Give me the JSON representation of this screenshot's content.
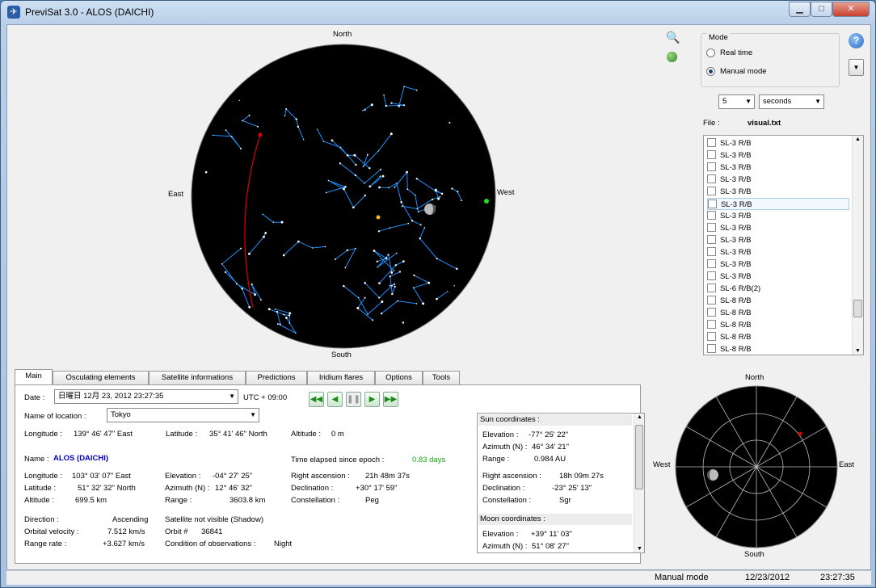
{
  "window": {
    "title": "PreviSat 3.0 - ALOS (DAICHI)",
    "minimize": "▁",
    "maximize": "□",
    "close": "✕"
  },
  "sky": {
    "north": "North",
    "south": "South",
    "east": "East",
    "west": "West"
  },
  "radar": {
    "north": "North",
    "south": "South",
    "east": "East",
    "west": "West"
  },
  "mode": {
    "title": "Mode",
    "real_time": "Real time",
    "manual": "Manual mode",
    "selected": "manual"
  },
  "step": {
    "value": "5",
    "unit": "seconds"
  },
  "file": {
    "label": "File :",
    "name": "visual.txt"
  },
  "satellites": [
    "SL-3 R/B",
    "SL-3 R/B",
    "SL-3 R/B",
    "SL-3 R/B",
    "SL-3 R/B",
    "SL-3 R/B",
    "SL-3 R/B",
    "SL-3 R/B",
    "SL-3 R/B",
    "SL-3 R/B",
    "SL-3 R/B",
    "SL-3 R/B",
    "SL-6 R/B(2)",
    "SL-8 R/B",
    "SL-8 R/B",
    "SL-8 R/B",
    "SL-8 R/B",
    "SL-8 R/B"
  ],
  "tabs": [
    "Main",
    "Osculating elements",
    "Satellite informations",
    "Predictions",
    "Iridium flares",
    "Options",
    "Tools"
  ],
  "main": {
    "date_label": "Date :",
    "date_value": "日曜日 12月 23, 2012  23:27:35",
    "utc_offset": "UTC + 09:00",
    "location_label": "Name of location :",
    "location_value": "Tokyo",
    "longitude_label": "Longitude :",
    "longitude_value": "139°  46' 47\" East",
    "latitude_label": "Latitude :",
    "latitude_value": "35°  41' 46\" North",
    "altitude_label": "Altitude :",
    "altitude_value": "0 m",
    "name_label": "Name :",
    "sat_name": "ALOS (DAICHI)",
    "epoch_label": "Time elapsed since epoch :",
    "epoch_value": "0.83 days",
    "sat_longitude_label": "Longitude :",
    "sat_longitude_value": "103°  03' 07\" East",
    "sat_latitude_label": "Latitude :",
    "sat_latitude_value": "51°  32' 32\" North",
    "sat_altitude_label": "Altitude :",
    "sat_altitude_value": "699.5 km",
    "elevation_label": "Elevation :",
    "elevation_value": "-04°  27' 25\"",
    "azimuth_label": "Azimuth (N) :",
    "azimuth_value": "12°  46' 32\"",
    "range_label": "Range :",
    "range_value": "3603.8 km",
    "ra_label": "Right ascension :",
    "ra_value": "21h 48m 37s",
    "dec_label": "Declination :",
    "dec_value": "+30°  17' 59\"",
    "const_label": "Constellation :",
    "const_value": "Peg",
    "direction_label": "Direction :",
    "direction_value": "Ascending",
    "visibility": "Satellite not visible (Shadow)",
    "orbvel_label": "Orbital velocity :",
    "orbvel_value": "7.512 km/s",
    "orbit_label": "Orbit #",
    "orbit_value": "36841",
    "rangerate_label": "Range rate :",
    "rangerate_value": "+3.627 km/s",
    "condition_label": "Condition of observations :",
    "condition_value": "Night"
  },
  "sun": {
    "title": "Sun coordinates :",
    "elevation_label": "Elevation :",
    "elevation_value": "-77°  25' 22\"",
    "azimuth_label": "Azimuth (N) :",
    "azimuth_value": "46°  34' 21\"",
    "range_label": "Range :",
    "range_value": "0.984 AU",
    "ra_label": "Right ascension :",
    "ra_value": "18h 09m 27s",
    "dec_label": "Declination :",
    "dec_value": "-23°  25' 13\"",
    "const_label": "Constellation :",
    "const_value": "Sgr"
  },
  "moon": {
    "title": "Moon coordinates :",
    "elevation_label": "Elevation :",
    "elevation_value": "+39°  11' 03\"",
    "azimuth_label": "Azimuth (N) :",
    "azimuth_value": "51°  08' 27\""
  },
  "status": {
    "mode": "Manual mode",
    "date": "12/23/2012",
    "time": "23:27:35"
  },
  "colors": {
    "sky_bg": "#000000",
    "constellation": "#1e90ff",
    "track": "#e00000",
    "satellite_name": "#0000cc",
    "epoch_value": "#11aa11"
  }
}
